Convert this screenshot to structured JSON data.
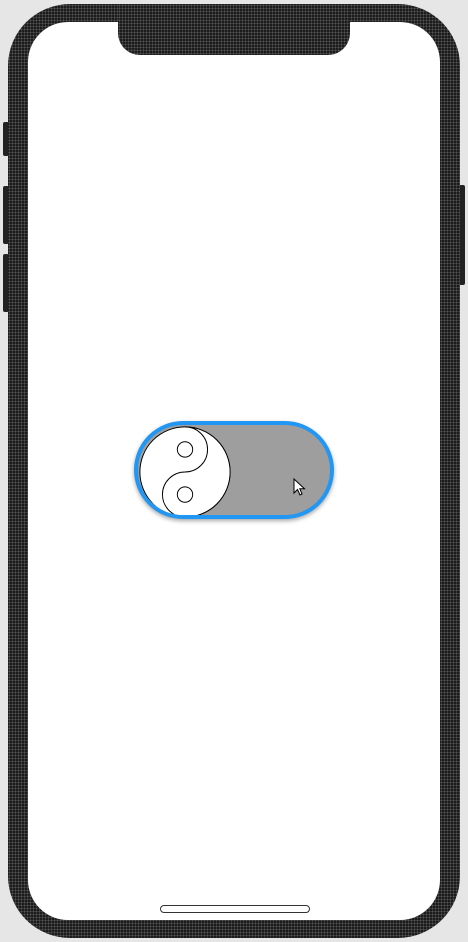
{
  "device": {
    "frame_color": "#1c1c1c",
    "screen_color": "#ffffff"
  },
  "toggle": {
    "state": "off",
    "checked": false,
    "border_color": "#2196F3",
    "track_color": "#9e9e9e",
    "knob_icon": "yin-yang-icon"
  }
}
